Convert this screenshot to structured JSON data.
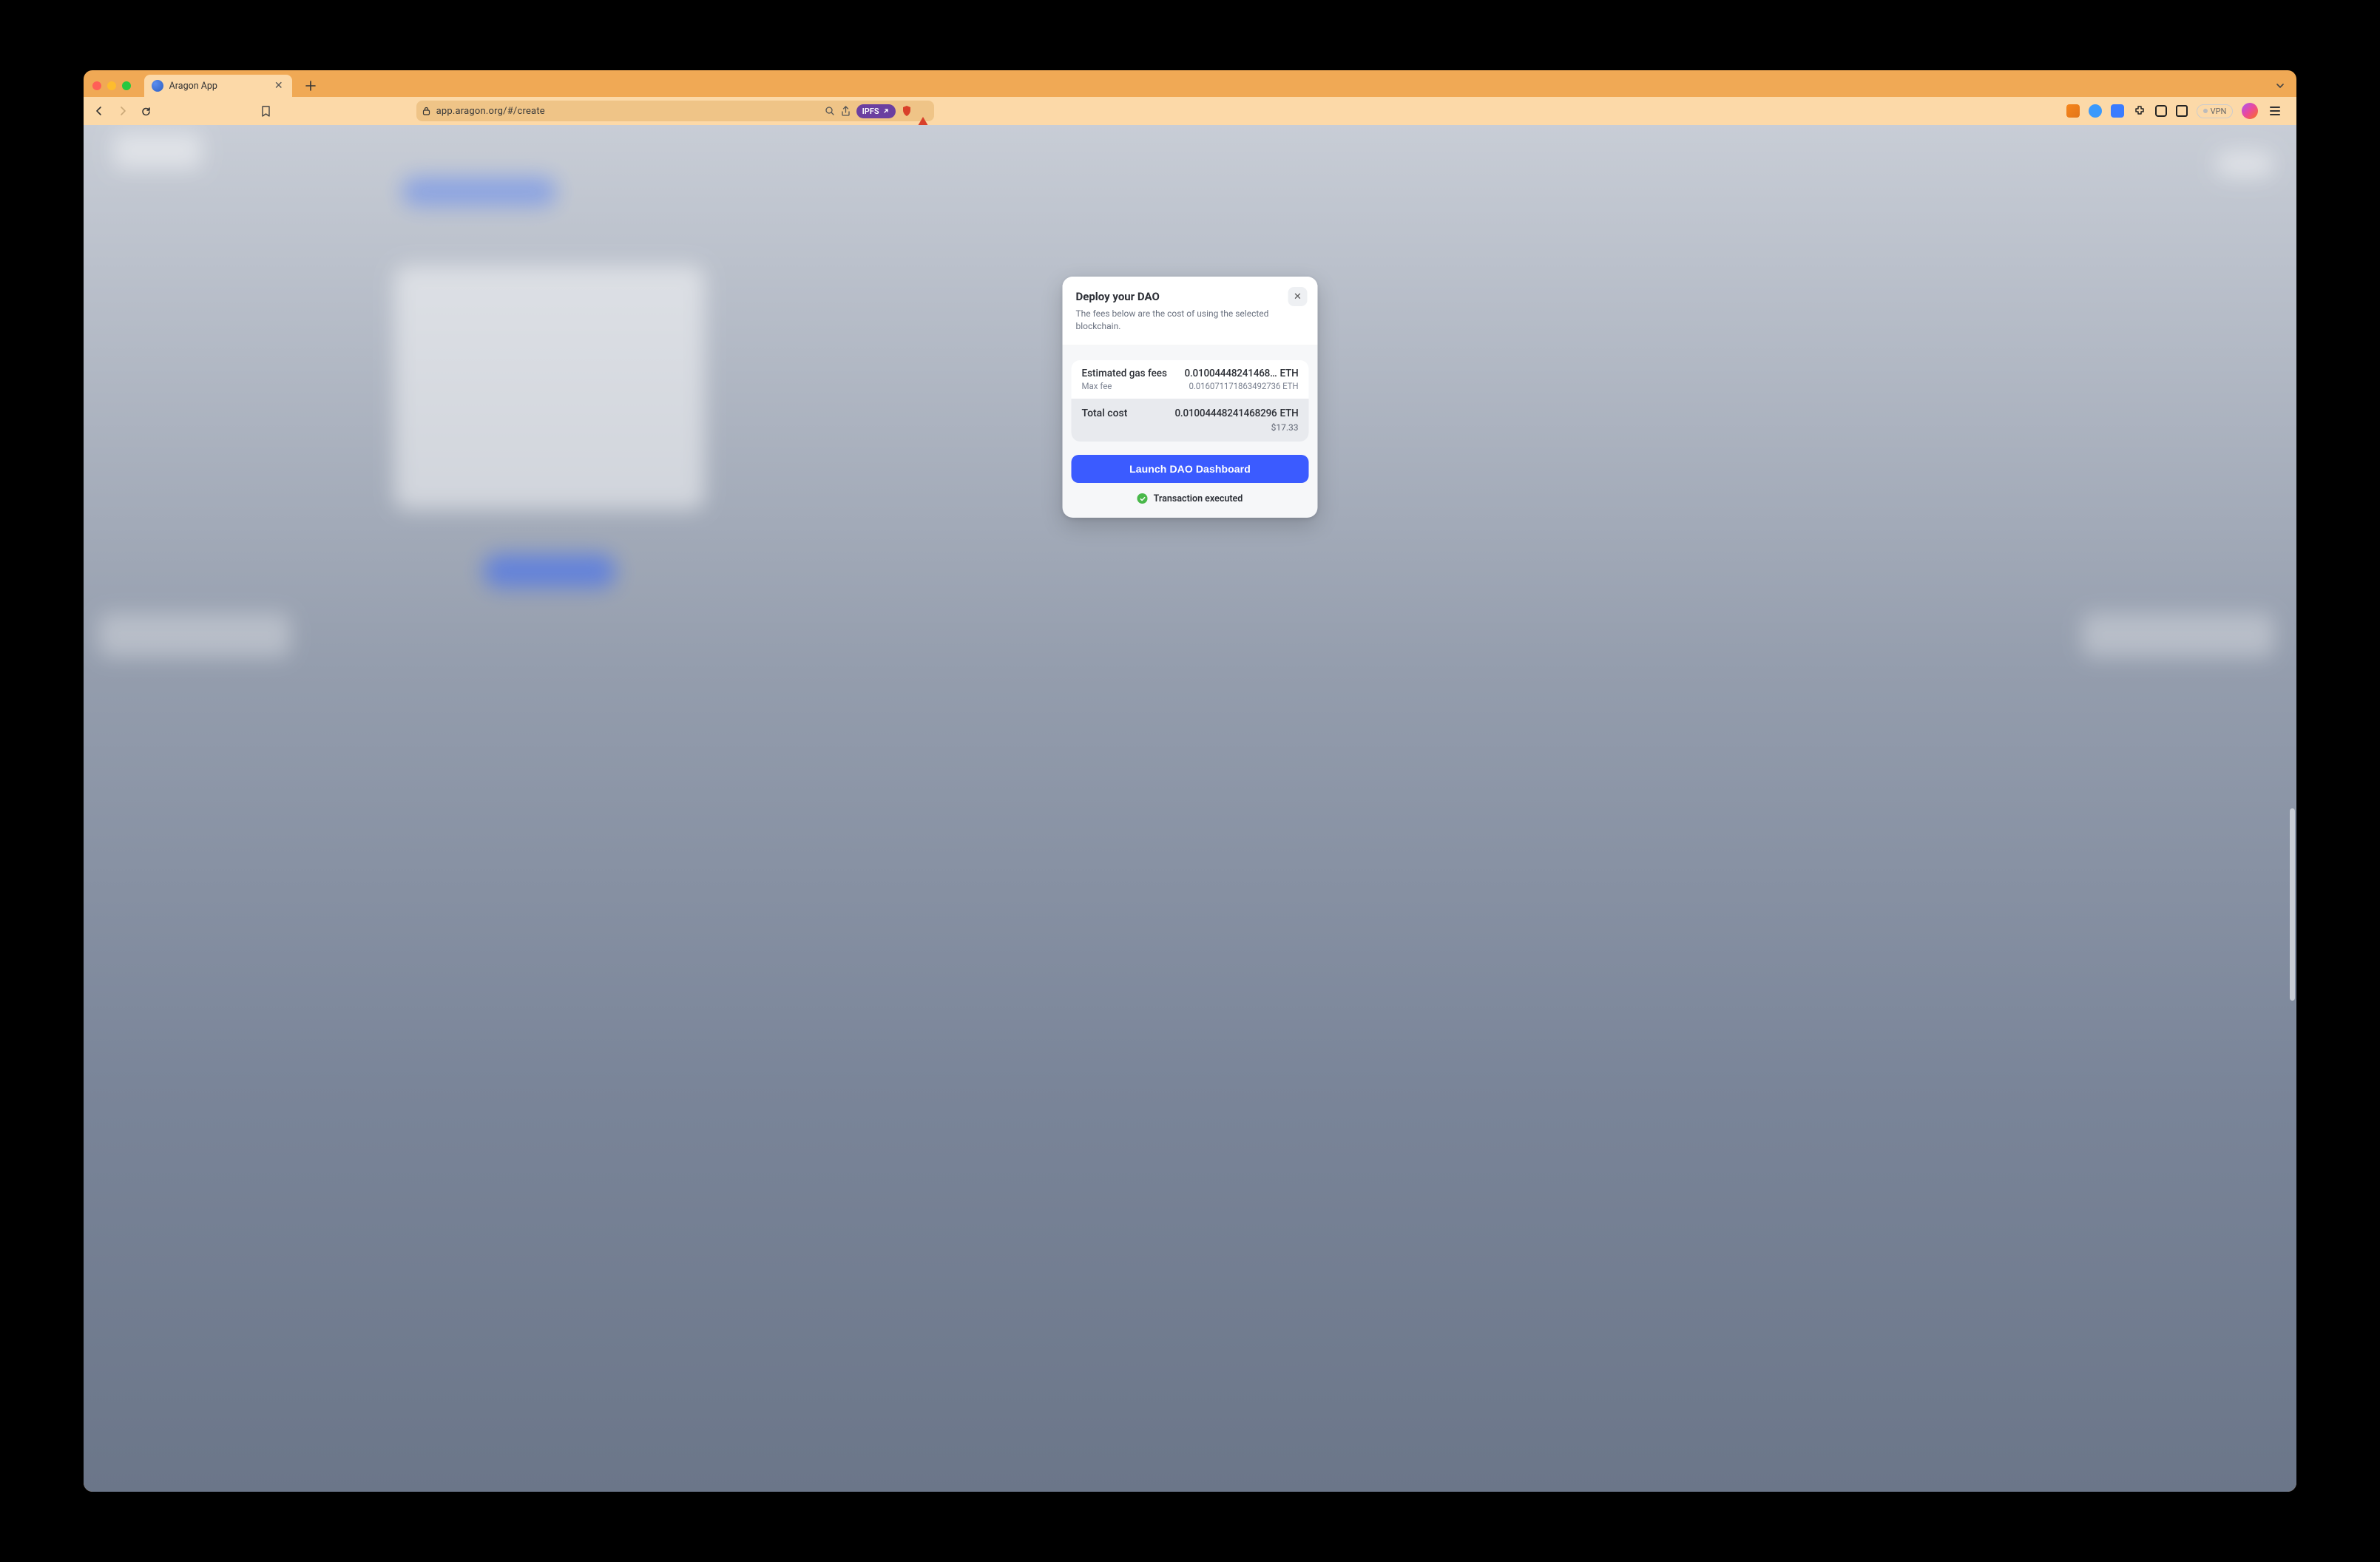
{
  "browser": {
    "tab_title": "Aragon App",
    "url": "app.aragon.org/#/create",
    "ipfs_pill": "IPFS",
    "vpn_label": "VPN"
  },
  "modal": {
    "title": "Deploy your DAO",
    "subtitle": "The fees below are the cost of using the selected blockchain.",
    "gas": {
      "label": "Estimated gas fees",
      "amount": "0.01004448241468…",
      "currency": "ETH",
      "max_label": "Max fee",
      "max_amount": "0.016071171863492736",
      "max_currency": "ETH"
    },
    "total": {
      "label": "Total cost",
      "amount": "0.01004448241468296",
      "currency": "ETH",
      "usd": "$17.33"
    },
    "cta": "Launch DAO Dashboard",
    "status": "Transaction executed"
  },
  "colors": {
    "primary": "#3b5bff",
    "success": "#49b84a"
  }
}
